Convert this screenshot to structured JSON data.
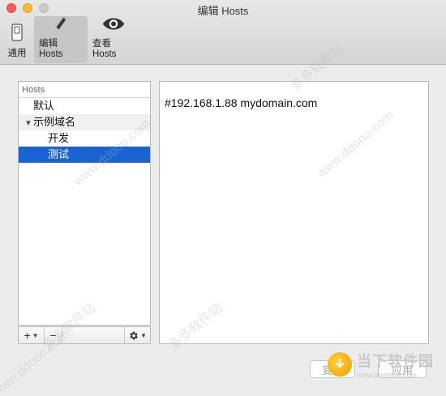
{
  "window": {
    "title": "编辑 Hosts"
  },
  "toolbar": {
    "items": [
      {
        "label": "通用",
        "icon": "switch-icon"
      },
      {
        "label": "编辑 Hosts",
        "icon": "pencil-icon"
      },
      {
        "label": "查看 Hosts",
        "icon": "eye-icon"
      }
    ],
    "active": "编辑 Hosts"
  },
  "sidebar": {
    "header": "Hosts",
    "items": [
      {
        "label": "默认",
        "level": 0
      },
      {
        "label": "示例域名",
        "level": 0,
        "expanded": true
      },
      {
        "label": "开发",
        "level": 1
      },
      {
        "label": "测试",
        "level": 1,
        "selected": true
      }
    ],
    "controls": {
      "add": "+",
      "remove": "−"
    }
  },
  "editor": {
    "content": "#192.168.1.88 mydomain.com"
  },
  "footer": {
    "revert_label": "复原",
    "apply_label": "应用"
  },
  "watermark": {
    "brand": "当下软件园",
    "url": "www.downxia.com",
    "texts": [
      "www.ddooo.com",
      "多多软件站",
      "www.ddooo.com",
      "多多软件站",
      "www.ddooo.com",
      "多多软件站"
    ]
  },
  "colors": {
    "selection": "#1a63d2",
    "close": "#fc5f57",
    "minimize": "#fdbc2e"
  }
}
